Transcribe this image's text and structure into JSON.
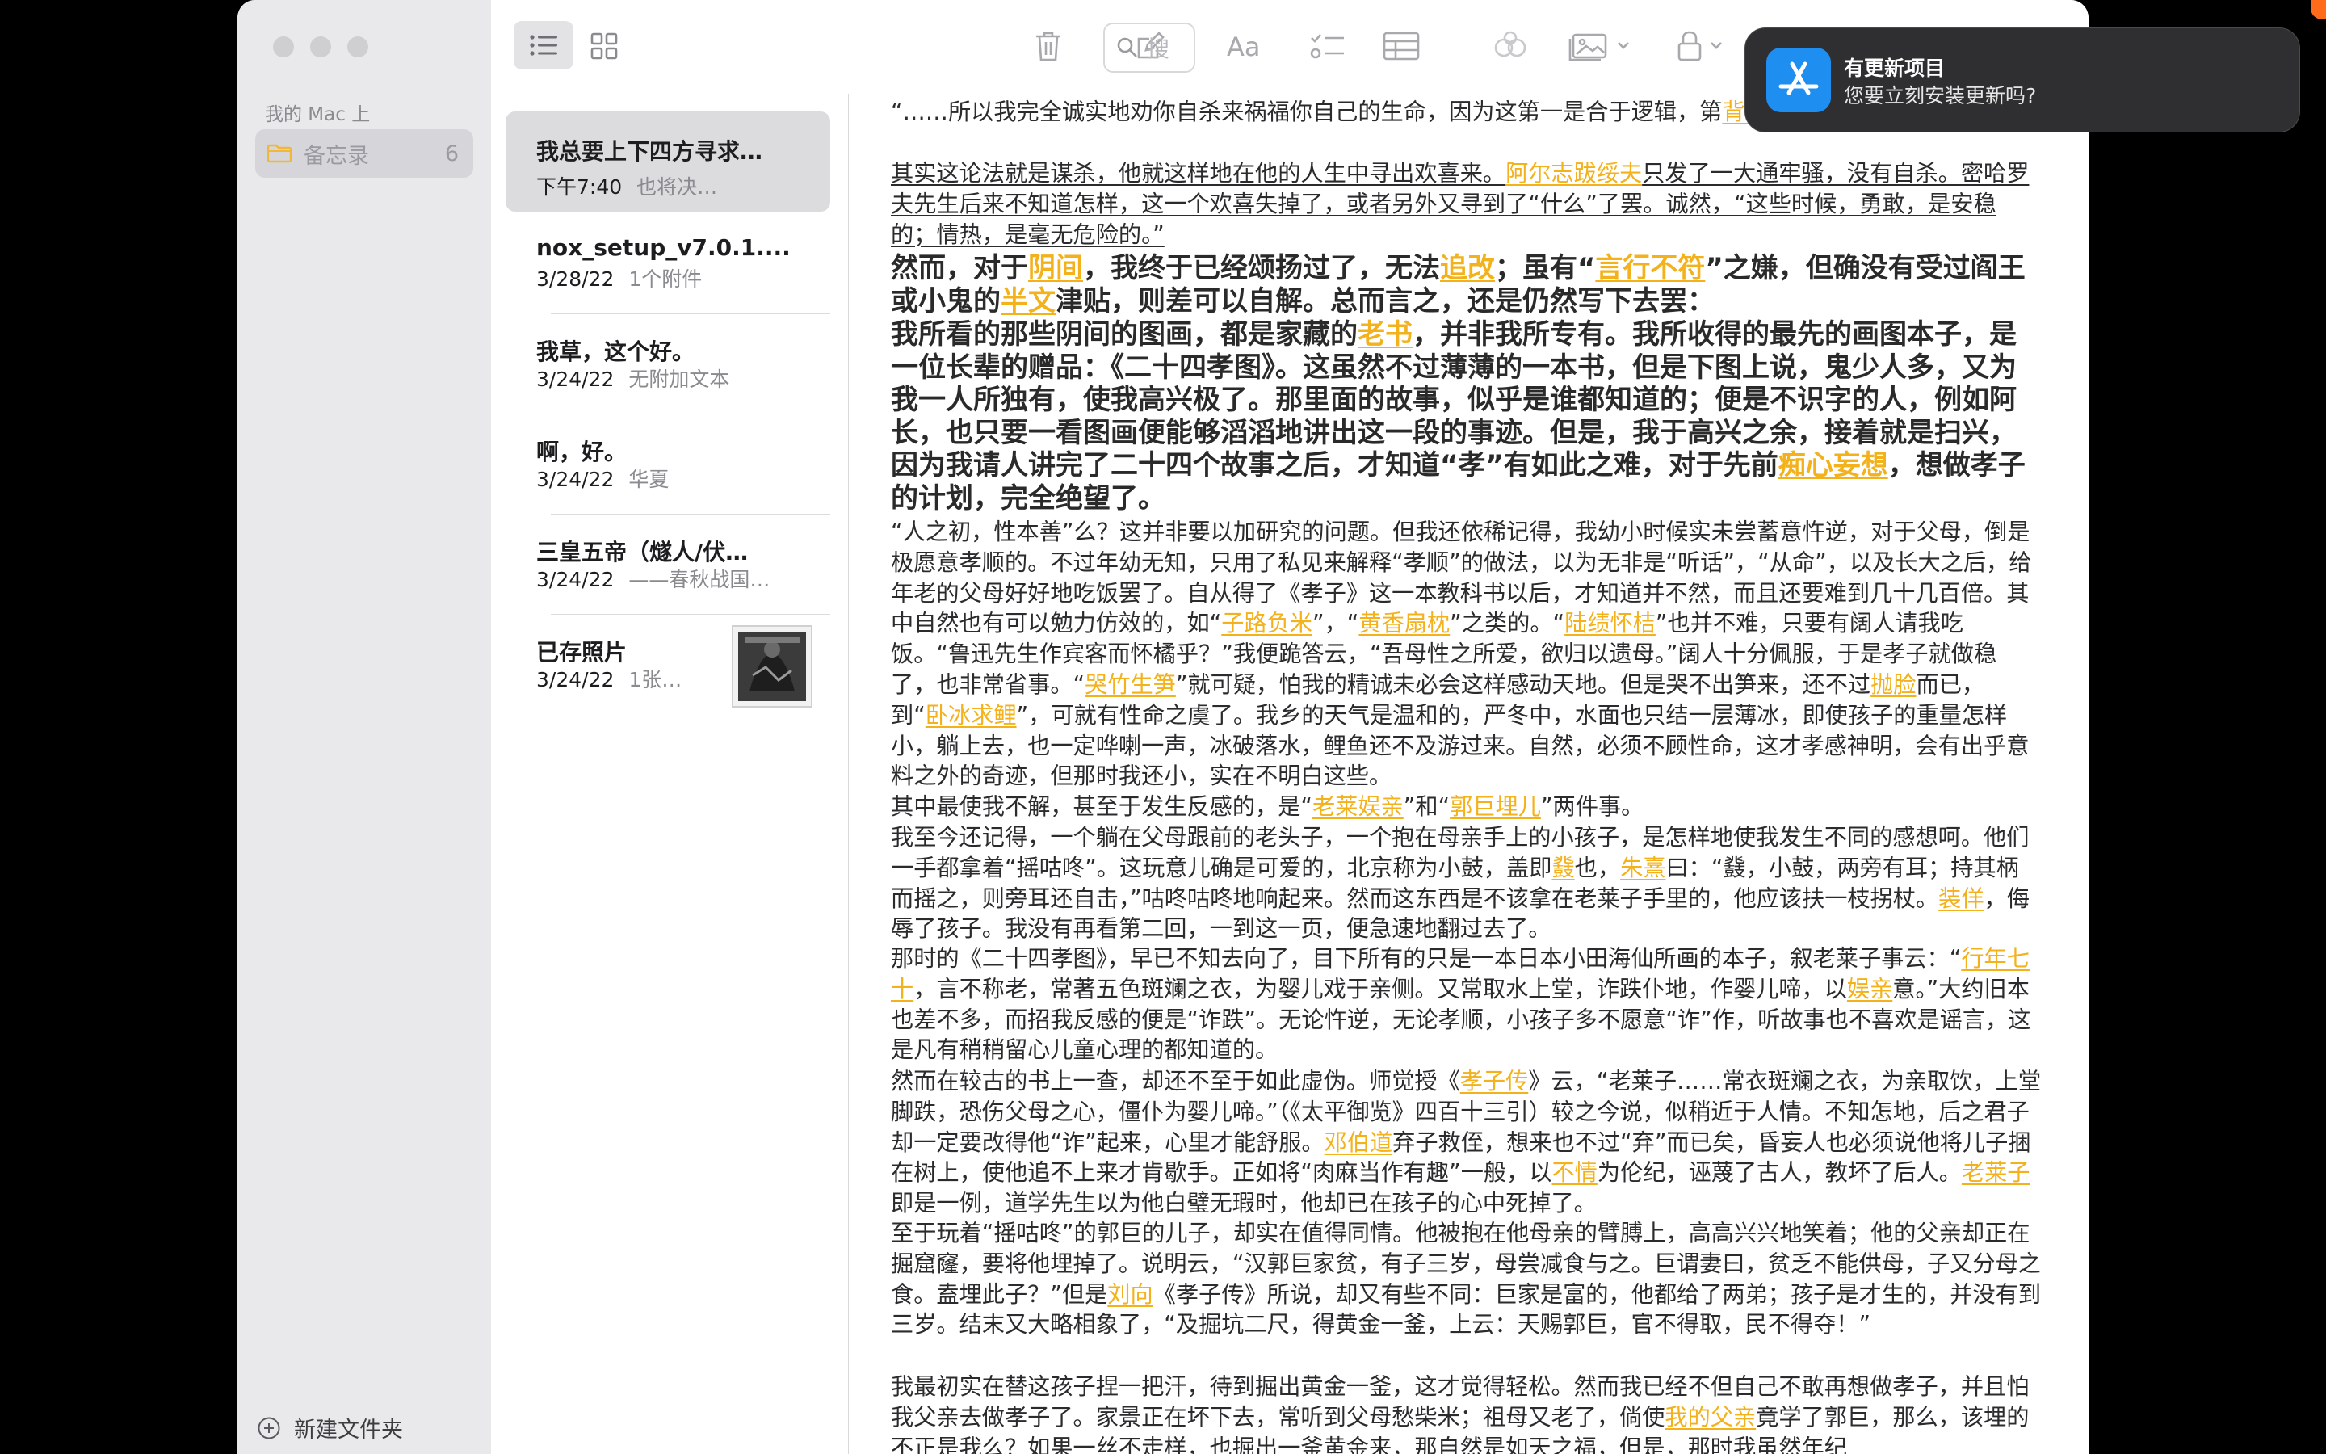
{
  "sidebar": {
    "section_header": "我的 Mac 上",
    "folder": {
      "label": "备忘录",
      "count": "6"
    },
    "new_folder_label": "新建文件夹"
  },
  "toolbar": {
    "search_placeholder": "搜"
  },
  "notes": [
    {
      "title": "我总要上下四方寻求…",
      "date": "下午7:40",
      "preview": "也将决…",
      "selected": true
    },
    {
      "title": "nox_setup_v7.0.1....",
      "date": "3/28/22",
      "preview": "1个附件"
    },
    {
      "title": "我草，这个好。",
      "date": "3/24/22",
      "preview": "无附加文本"
    },
    {
      "title": "啊，好。",
      "date": "3/24/22",
      "preview": "华夏"
    },
    {
      "title": "三皇五帝（燧人/伏…",
      "date": "3/24/22",
      "preview": "——春秋战国…"
    },
    {
      "title": "已存照片",
      "date": "3/24/22",
      "preview": "1张…"
    }
  ],
  "notification": {
    "title": "有更新项目",
    "body": "您要立刻安装更新吗?"
  },
  "editor": {
    "p1": [
      "“……所以我完全诚实地劝你自杀来祸福你自己的生命，因为这第一是合于逻辑，第",
      {
        "hl": "背驰"
      },
      "。”"
    ],
    "p2": [
      "其实这论法就是谋杀，他就这样地在他的人生中寻出欢喜来。",
      {
        "hl": "阿尔志跋绥夫"
      },
      "只发了一大通牢骚，没有自杀。密哈罗夫先生后来不知道怎样，这一个欢喜失掉了，或者另外又寻到了“什么”了罢。诚然，“这些时候，勇敢，是安稳的；情热，是毫无危险的。”"
    ],
    "p3": [
      "然而，对于",
      {
        "hl": "阴间"
      },
      "，我终于已经颂扬过了，无法",
      {
        "hl": "追改"
      },
      "；虽有“",
      {
        "hl": "言行不符"
      },
      "”之嫌，但确没有受过阎王或小鬼的",
      {
        "hl": "半文"
      },
      "津贴，则差可以自解。总而言之，还是仍然写下去罢："
    ],
    "p4": [
      "我所看的那些阴间的图画，都是家藏的",
      {
        "hl": "老书"
      },
      "，并非我所专有。我所收得的最先的画图本子，是一位长辈的赠品：《二十四孝图》。这虽然不过薄薄的一本书，但是下图上说，鬼少人多，又为我一人所独有，使我高兴极了。那里面的故事，似乎是谁都知道的；便是不识字的人，例如阿长，也只要一看图画便能够滔滔地讲出这一段的事迹。但是，我于高兴之余，接着就是扫兴，因为我请人讲完了二十四个故事之后，才知道“孝”有如此之难，对于先前",
      {
        "hl": "痴心妄想"
      },
      "，想做孝子的计划，完全绝望了。"
    ],
    "p5": [
      "“人之初，性本善”么？这并非要以加研究的问题。但我还依稀记得，我幼小时候实未尝蓄意忤逆，对于父母，倒是极愿意孝顺的。不过年幼无知，只用了私见来解释“孝顺”的做法，以为无非是“听话”，“从命”，以及长大之后，给年老的父母好好地吃饭罢了。自从得了《孝子》这一本教科书以后，才知道并不然，而且还要难到几十几百倍。其中自然也有可以勉力仿效的，如“",
      {
        "hl": "子路负米"
      },
      "”，“",
      {
        "hl": "黄香扇枕"
      },
      "”之类的。“",
      {
        "hl": "陆绩怀桔"
      },
      "”也并不难，只要有阔人请我吃饭。“鲁迅先生作宾客而怀橘乎？”我便跪答云，“吾母性之所爱，欲归以遗母。”阔人十分佩服，于是孝子就做稳了，也非常省事。“",
      {
        "hl": "哭竹生笋"
      },
      "”就可疑，怕我的精诚未必会这样感动天地。但是哭不出笋来，还不过",
      {
        "hl": "抛脸"
      },
      "而已，到“",
      {
        "hl": "卧冰求鲤"
      },
      "”，可就有性命之虞了。我乡的天气是温和的，严冬中，水面也只结一层薄冰，即使孩子的重量怎样小，躺上去，也一定哗喇一声，冰破落水，鲤鱼还不及游过来。自然，必须不顾性命，这才孝感神明，会有出乎意料之外的奇迹，但那时我还小，实在不明白这些。"
    ],
    "p6": [
      "其中最使我不解，甚至于发生反感的，是“",
      {
        "hl": "老莱娱亲"
      },
      "”和“",
      {
        "hl": "郭巨埋儿"
      },
      "”两件事。"
    ],
    "p7": [
      "我至今还记得，一个躺在父母跟前的老头子，一个抱在母亲手上的小孩子，是怎样地使我发生不同的感想呵。他们一手都拿着“摇咕咚”。这玩意儿确是可爱的，北京称为小鼓，盖即",
      {
        "hl": "鼗"
      },
      "也，",
      {
        "hl": "朱熹"
      },
      "曰：“鼗，小鼓，两旁有耳；持其柄而摇之，则旁耳还自击，”咕咚咕咚地响起来。然而这东西是不该拿在老莱子手里的，他应该扶一枝拐杖。",
      {
        "hl": "装佯"
      },
      "，侮辱了孩子。我没有再看第二回，一到这一页，便急速地翻过去了。"
    ],
    "p8": [
      "那时的《二十四孝图》，早已不知去向了，目下所有的只是一本日本小田海仙所画的本子，叙老莱子事云：“",
      {
        "hl": "行年七十"
      },
      "，言不称老，常著五色斑斓之衣，为婴儿戏于亲侧。又常取水上堂，诈跌仆地，作婴儿啼，以",
      {
        "hl": "娱亲"
      },
      "意。”大约旧本也差不多，而招我反感的便是“诈跌”。无论忤逆，无论孝顺，小孩子多不愿意“诈”作，听故事也不喜欢是谣言，这是凡有稍稍留心儿童心理的都知道的。"
    ],
    "p9": [
      "然而在较古的书上一查，却还不至于如此虚伪。师觉授《",
      {
        "hl": "孝子传"
      },
      "》云，“老莱子……常衣斑斓之衣，为亲取饮，上堂脚跌，恐伤父母之心，僵仆为婴儿啼。”（《太平御览》四百十三引）较之今说，似稍近于人情。不知怎地，后之君子却一定要改得他“诈”起来，心里才能舒服。",
      {
        "hl": "邓伯道"
      },
      "弃子救侄，想来也不过“弃”而已矣，昏妄人也必须说他将儿子捆在树上，使他追不上来才肯歇手。正如将“肉麻当作有趣”一般，以",
      {
        "hl": "不情"
      },
      "为伦纪，诬蔑了古人，教坏了后人。",
      {
        "hl": "老莱子"
      },
      "即是一例，道学先生以为他白璧无瑕时，他却已在孩子的心中死掉了。"
    ],
    "p10": [
      "至于玩着“摇咕咚”的郭巨的儿子，却实在值得同情。他被抱在他母亲的臂膊上，高高兴兴地笑着；他的父亲却正在掘窟窿，要将他埋掉了。说明云，“汉郭巨家贫，有子三岁，母尝减食与之。巨谓妻曰，贫乏不能供母，子又分母之食。盍埋此子？”但是",
      {
        "hl": "刘向"
      },
      "《孝子传》所说，却又有些不同：巨家是富的，他都给了两弟；孩子是才生的，并没有到三岁。结末又大略相象了，“及掘坑二尺，得黄金一釜，上云：天赐郭巨，官不得取，民不得夺！”"
    ],
    "p11": [
      "我最初实在替这孩子捏一把汗，待到掘出黄金一釜，这才觉得轻松。然而我已经不但自己不敢再想做孝子，并且怕我父亲去做孝子了。家景正在坏下去，常听到父母愁柴米；祖母又老了，倘使",
      {
        "hl": "我的父亲"
      },
      "竟学了郭巨，那么，该埋的不正是我么？如果一丝不走样，也掘出一釜黄金来，那自然是如天之福，但是，那时我虽然年纪"
    ]
  }
}
